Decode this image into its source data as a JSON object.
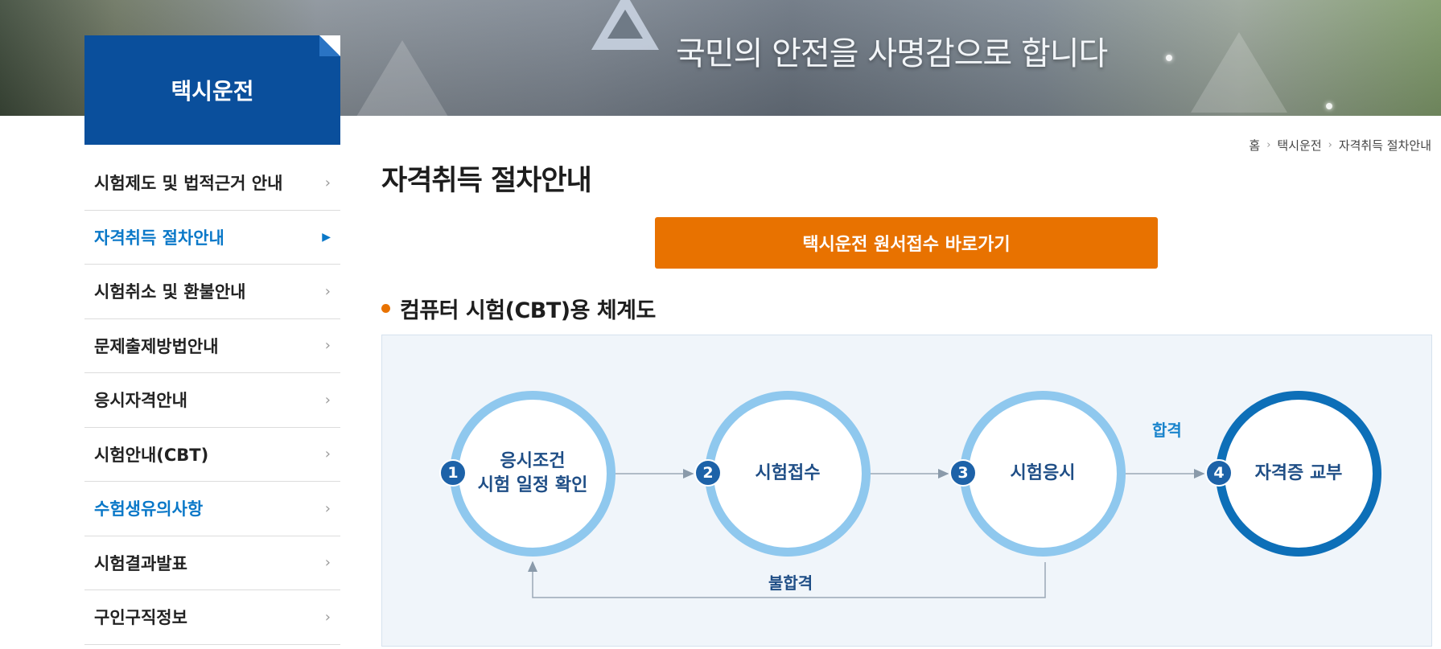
{
  "banner": {
    "slogan": "국민의 안전을 사명감으로 합니다"
  },
  "sidebar": {
    "title": "택시운전",
    "items": [
      {
        "label": "시험제도 및 법적근거 안내",
        "state": "normal"
      },
      {
        "label": "자격취득 절차안내",
        "state": "active"
      },
      {
        "label": "시험취소 및 환불안내",
        "state": "normal"
      },
      {
        "label": "문제출제방법안내",
        "state": "normal"
      },
      {
        "label": "응시자격안내",
        "state": "normal"
      },
      {
        "label": "시험안내(CBT)",
        "state": "normal"
      },
      {
        "label": "수험생유의사항",
        "state": "highlight"
      },
      {
        "label": "시험결과발표",
        "state": "normal"
      },
      {
        "label": "구인구직정보",
        "state": "normal"
      }
    ]
  },
  "breadcrumb": [
    "홈",
    "택시운전",
    "자격취득 절차안내"
  ],
  "main": {
    "title": "자격취득 절차안내",
    "apply_button": "택시운전 원서접수 바로가기",
    "section_heading": "컴퓨터 시험(CBT)용 체계도",
    "diagram": {
      "steps": [
        {
          "num": "1",
          "line1": "응시조건",
          "line2": "시험 일정 확인"
        },
        {
          "num": "2",
          "line1": "시험접수",
          "line2": ""
        },
        {
          "num": "3",
          "line1": "시험응시",
          "line2": ""
        },
        {
          "num": "4",
          "line1": "자격증 교부",
          "line2": ""
        }
      ],
      "pass_label": "합격",
      "fail_label": "불합격"
    }
  },
  "colors": {
    "brand_blue": "#0a4f9c",
    "accent_orange": "#e87200",
    "active_link": "#0a78c8"
  }
}
